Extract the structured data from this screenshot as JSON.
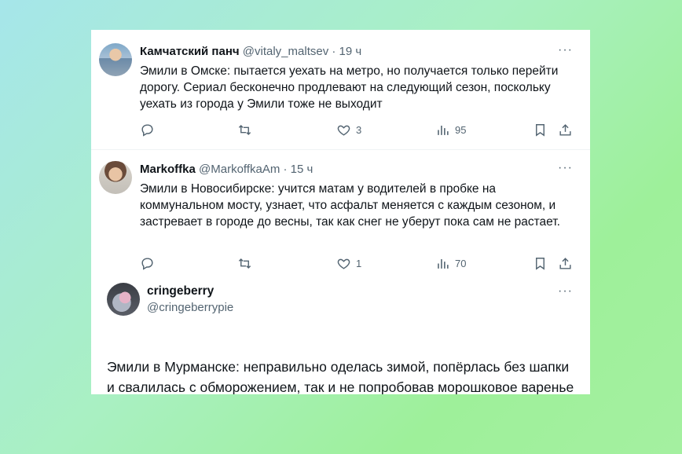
{
  "tweets": [
    {
      "name": "Камчатский панч",
      "handle": "@vitaly_maltsev",
      "time": "· 19 ч",
      "text": "Эмили в Омске: пытается уехать на метро, но получается только перейти дорогу. Сериал бесконечно продлевают на следующий сезон, поскольку уехать из города у Эмили тоже не выходит",
      "likes": "3",
      "views": "95",
      "more": "···"
    },
    {
      "name": "Markoffka",
      "handle": "@MarkoffkaAm",
      "time": "· 15 ч",
      "text": "Эмили в Новосибирске: учится матам у водителей в пробке на коммунальном мосту, узнает, что асфальт меняется с каждым сезоном, и застревает в городе до весны, так как снег не уберут пока сам не растает.",
      "likes": "1",
      "views": "70",
      "more": "···"
    },
    {
      "name": "cringeberry",
      "handle": "@cringeberrypie",
      "text": "Эмили в Мурманске: неправильно оделась зимой, попёрлась без шапки и свалилась с обморожением, так и не попробовав морошковое варенье и чипсы из ягеля",
      "more": "···"
    }
  ],
  "colors": {
    "text": "#0f1419",
    "secondary": "#536471",
    "card": "#ffffff"
  },
  "icons": [
    "reply-icon",
    "retweet-icon",
    "like-icon",
    "views-icon",
    "bookmark-icon",
    "share-icon",
    "more-icon"
  ]
}
